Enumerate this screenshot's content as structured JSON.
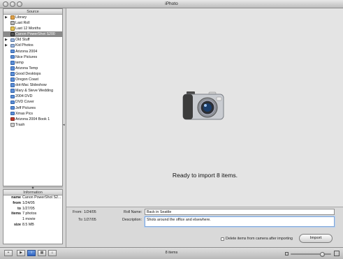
{
  "window": {
    "title": "iPhoto"
  },
  "source": {
    "header": "Source",
    "items": [
      {
        "label": "Library",
        "icon": "library-icon",
        "kind": "lib",
        "disclosure": true
      },
      {
        "label": "Last Roll",
        "icon": "film-roll-icon",
        "kind": "film"
      },
      {
        "label": "Last 12 Months",
        "icon": "calendar-icon",
        "kind": "cal"
      },
      {
        "label": "Canon PowerShot S200",
        "icon": "camera-icon",
        "kind": "cam",
        "selected": true
      },
      {
        "label": "Old Stuff",
        "icon": "folder-icon",
        "kind": "folder",
        "disclosure": true
      },
      {
        "label": "Kid Photos",
        "icon": "folder-icon",
        "kind": "folder",
        "disclosure": true
      },
      {
        "label": "Arizona 2004",
        "icon": "album-icon",
        "kind": "album"
      },
      {
        "label": "Nice Pictures",
        "icon": "album-icon",
        "kind": "album"
      },
      {
        "label": "temp",
        "icon": "album-icon",
        "kind": "album"
      },
      {
        "label": "Arizona Temp",
        "icon": "album-icon",
        "kind": "album"
      },
      {
        "label": "Good Desktops",
        "icon": "album-icon",
        "kind": "album"
      },
      {
        "label": "Oregon Coast",
        "icon": "album-icon",
        "kind": "album"
      },
      {
        "label": "dot-Mac Slideshow",
        "icon": "album-icon",
        "kind": "album"
      },
      {
        "label": "Mary & Steve Wedding",
        "icon": "album-icon",
        "kind": "album"
      },
      {
        "label": "2004 DVD",
        "icon": "album-icon",
        "kind": "album"
      },
      {
        "label": "DVD Cover",
        "icon": "album-icon",
        "kind": "album"
      },
      {
        "label": "Jeff Pictures",
        "icon": "album-icon",
        "kind": "album"
      },
      {
        "label": "Xmas Pics",
        "icon": "album-icon",
        "kind": "album"
      },
      {
        "label": "Arizona 2004 Book 1",
        "icon": "book-icon",
        "kind": "book"
      },
      {
        "label": "Trash",
        "icon": "trash-icon",
        "kind": "trash"
      }
    ]
  },
  "information": {
    "header": "Information",
    "rows": [
      {
        "key": "name",
        "value": "Canon PowerShot S2..."
      },
      {
        "key": "from",
        "value": "1/24/05"
      },
      {
        "key": "to",
        "value": "1/27/05"
      },
      {
        "key": "items",
        "value": "7 photos"
      },
      {
        "key": "",
        "value": "1 movie"
      },
      {
        "key": "size",
        "value": "8.5 MB"
      }
    ]
  },
  "viewer": {
    "status": "Ready to import 8 items."
  },
  "import": {
    "from_label": "From:",
    "from_value": "1/24/05",
    "to_label": "To:",
    "to_value": "1/27/05",
    "roll_name_label": "Roll Name:",
    "roll_name_value": "Back in Seattle",
    "description_label": "Description:",
    "description_value": "Shots around the office and elsewhere.",
    "delete_label": "Delete items from camera after importing",
    "delete_checked": false,
    "import_button": "Import"
  },
  "bottom": {
    "count": "8 items",
    "buttons": [
      {
        "glyph": "+",
        "name": "add-album-button",
        "active": false
      },
      {
        "glyph": "▶",
        "name": "play-slideshow-button",
        "active": false
      },
      {
        "glyph": "i",
        "name": "info-button",
        "active": true
      },
      {
        "glyph": "▦",
        "name": "calendar-button",
        "active": false
      },
      {
        "glyph": "⌂",
        "name": "keywords-button",
        "active": false
      }
    ],
    "zoom_level": 0.78
  },
  "colors": {
    "selection": "#8a8a8a",
    "accent": "#2f64c2",
    "viewer_bg": "#e4e4e4"
  }
}
